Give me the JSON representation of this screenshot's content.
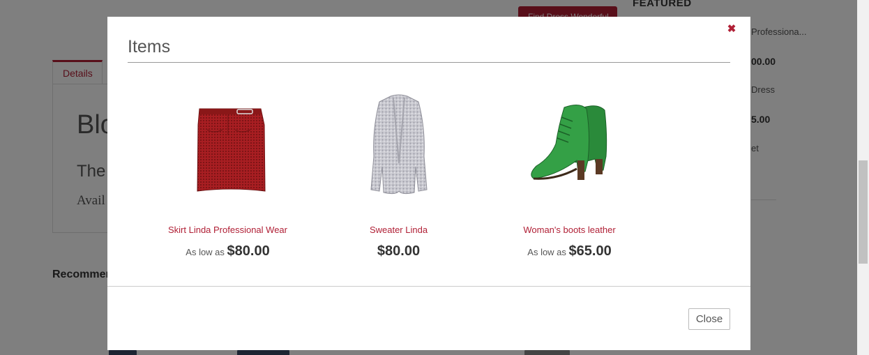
{
  "background": {
    "cta_button": "Find Dress Wonderful",
    "featured_heading": "FEATURED",
    "sidebar": {
      "product1_name": "Professiona...",
      "product1_price": "00.00",
      "product2_name": "Dress",
      "product2_price": "5.00",
      "product3_name": "et"
    },
    "tab_details": "Details",
    "content_title": "Blo",
    "content_subtitle": "The",
    "availability": "Avail",
    "recommended_heading": "Recommen"
  },
  "modal": {
    "title": "Items",
    "close_x": "✖",
    "items": [
      {
        "name": "Skirt Linda Professional Wear",
        "as_low_as": "As low as",
        "price": "$80.00",
        "image_icon": "red-skirt-image"
      },
      {
        "name": "Sweater Linda",
        "as_low_as": "",
        "price": "$80.00",
        "image_icon": "grey-cardigan-image"
      },
      {
        "name": "Woman's boots leather",
        "as_low_as": "As low as",
        "price": "$65.00",
        "image_icon": "green-boots-image"
      }
    ],
    "close_button": "Close"
  },
  "colors": {
    "accent": "#b01f35",
    "overlay": "rgba(0,0,0,0.5)"
  }
}
